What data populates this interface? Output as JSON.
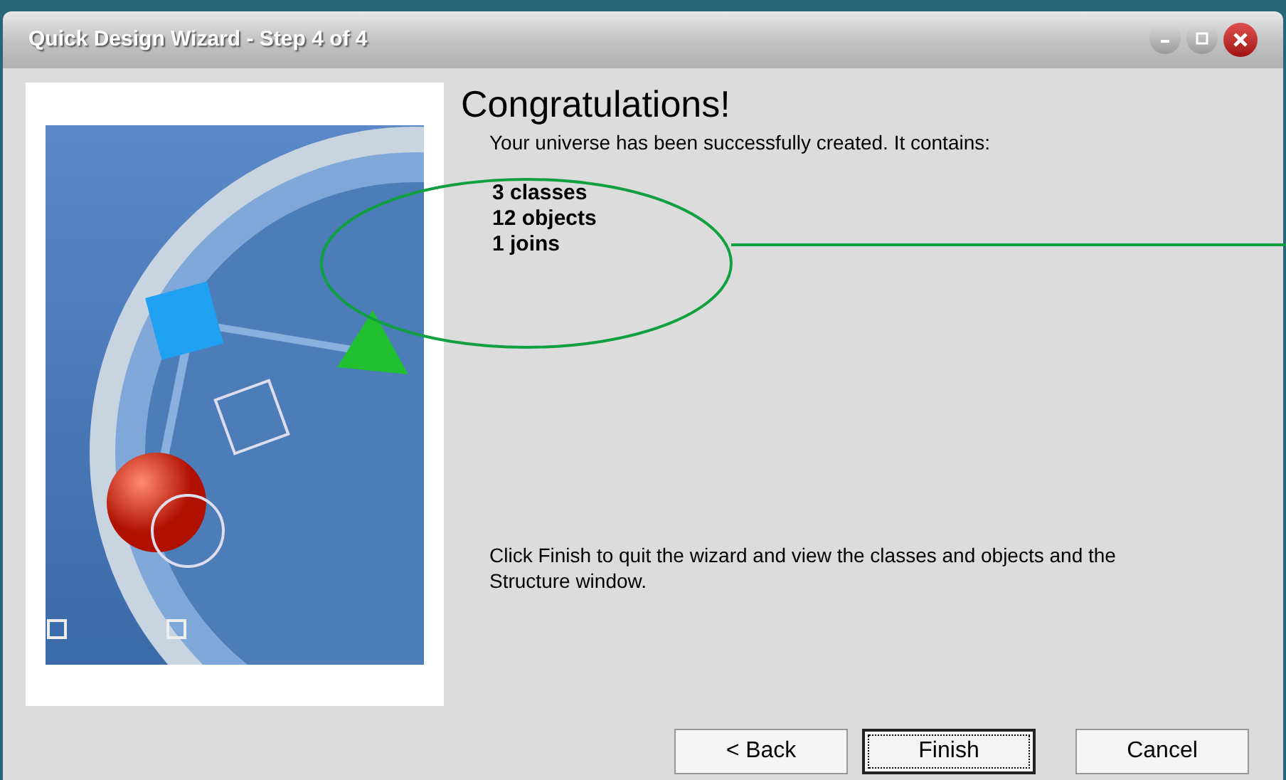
{
  "window": {
    "title": "Quick Design Wizard - Step 4 of 4"
  },
  "heading": "Congratulations!",
  "intro": "Your universe has been successfully created. It contains:",
  "summary": [
    "3 classes",
    "12 objects",
    "1 joins"
  ],
  "footer_text": "Click Finish to quit the wizard and view the classes and objects and the Structure window.",
  "buttons": [
    {
      "label": "< Back",
      "default": false
    },
    {
      "label": "Finish",
      "default": true
    },
    {
      "label": "Cancel",
      "default": false
    }
  ]
}
